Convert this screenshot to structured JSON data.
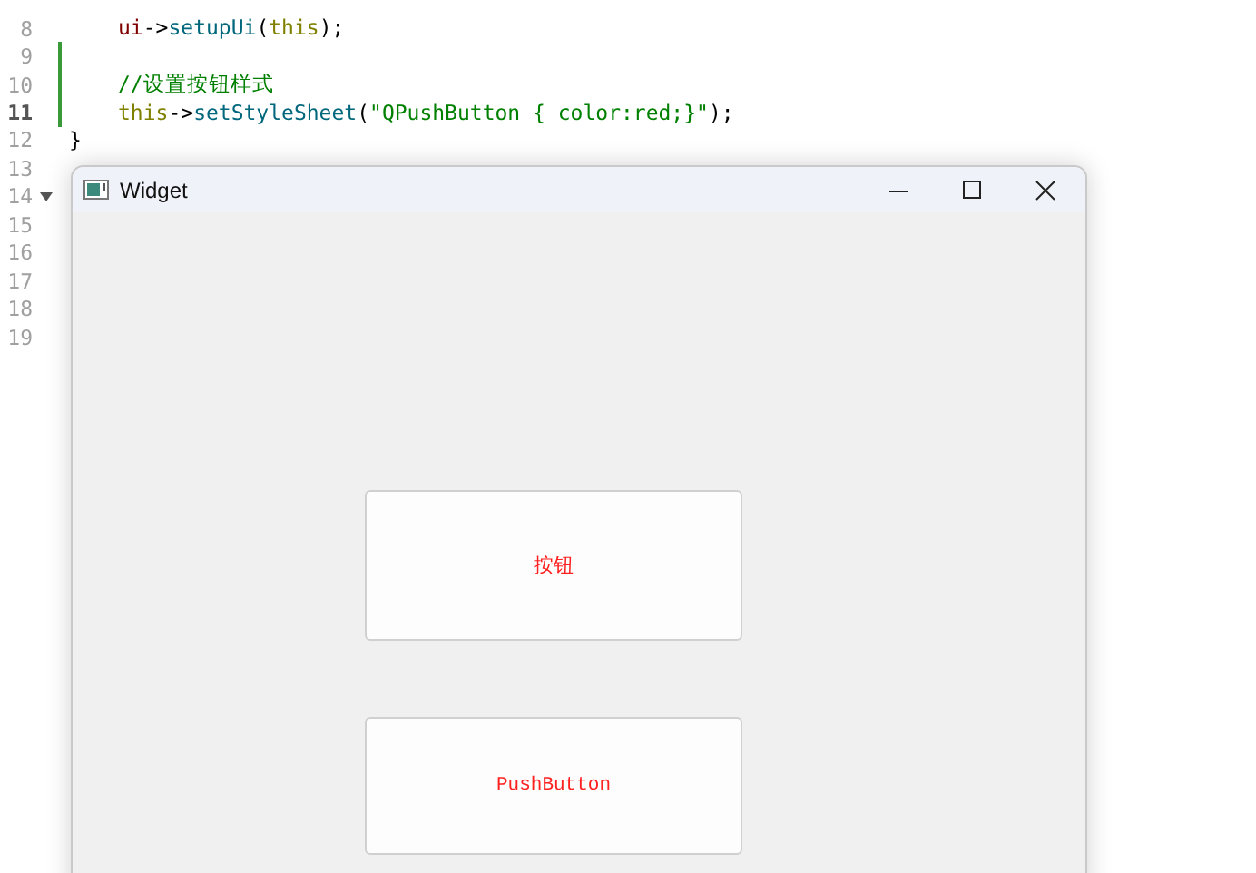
{
  "editor": {
    "lines": [
      {
        "number": "8",
        "modified": false,
        "current": false,
        "foldable": false,
        "indented": true,
        "tokens": [
          {
            "kind": "member",
            "text": "ui"
          },
          {
            "kind": "plain",
            "text": "->"
          },
          {
            "kind": "func",
            "text": "setupUi"
          },
          {
            "kind": "plain",
            "text": "("
          },
          {
            "kind": "keyword",
            "text": "this"
          },
          {
            "kind": "plain",
            "text": ");"
          }
        ]
      },
      {
        "number": "9",
        "modified": true,
        "current": false,
        "foldable": false
      },
      {
        "number": "10",
        "modified": true,
        "current": false,
        "foldable": false,
        "indented": true,
        "tokens": [
          {
            "kind": "comment",
            "text": "//设置按钮样式"
          }
        ]
      },
      {
        "number": "11",
        "modified": true,
        "current": true,
        "foldable": false,
        "indented": true,
        "tokens": [
          {
            "kind": "keyword",
            "text": "this"
          },
          {
            "kind": "plain",
            "text": "->"
          },
          {
            "kind": "func",
            "text": "setStyleSheet"
          },
          {
            "kind": "plain",
            "text": "("
          },
          {
            "kind": "string",
            "text": "\"QPushButton { color:red;}\""
          },
          {
            "kind": "plain",
            "text": ");"
          }
        ]
      },
      {
        "number": "12",
        "modified": false,
        "current": false,
        "foldable": false,
        "indented": false,
        "tokens": [
          {
            "kind": "plain",
            "text": "}"
          }
        ]
      },
      {
        "number": "13",
        "modified": false,
        "current": false,
        "foldable": false
      },
      {
        "number": "14",
        "modified": false,
        "current": false,
        "foldable": true
      },
      {
        "number": "15",
        "modified": false,
        "current": false,
        "foldable": false
      },
      {
        "number": "16",
        "modified": false,
        "current": false,
        "foldable": false
      },
      {
        "number": "17",
        "modified": false,
        "current": false,
        "foldable": false
      },
      {
        "number": "18",
        "modified": false,
        "current": false,
        "foldable": false
      },
      {
        "number": "19",
        "modified": false,
        "current": false,
        "foldable": false
      }
    ]
  },
  "window": {
    "title": "Widget",
    "buttons": [
      {
        "label": "按钮"
      },
      {
        "label": "PushButton"
      }
    ]
  }
}
